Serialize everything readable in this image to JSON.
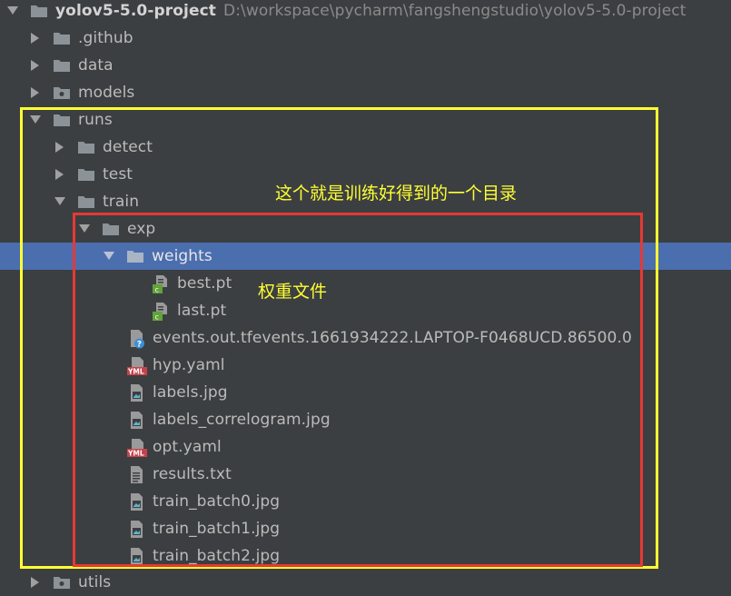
{
  "project": {
    "name": "yolov5-5.0-project",
    "path": "D:\\workspace\\pycharm\\fangshengstudio\\yolov5-5.0-project"
  },
  "tree": {
    "github": ".github",
    "data": "data",
    "models": "models",
    "runs": "runs",
    "detect": "detect",
    "test": "test",
    "train": "train",
    "exp": "exp",
    "weights": "weights",
    "best": "best.pt",
    "last": "last.pt",
    "events": "events.out.tfevents.1661934222.LAPTOP-F0468UCD.86500.0",
    "hyp": "hyp.yaml",
    "labels": "labels.jpg",
    "labels_correlogram": "labels_correlogram.jpg",
    "opt": "opt.yaml",
    "results": "results.txt",
    "train_batch0": "train_batch0.jpg",
    "train_batch1": "train_batch1.jpg",
    "train_batch2": "train_batch2.jpg",
    "utils": "utils"
  },
  "annotations": {
    "directory_note": "这个就是训练好得到的一个目录",
    "weights_note": "权重文件"
  },
  "colors": {
    "background": "#3c3f41",
    "selection": "#4b6eaf",
    "yellow_box": "#ffff33",
    "red_box": "#e53935"
  }
}
